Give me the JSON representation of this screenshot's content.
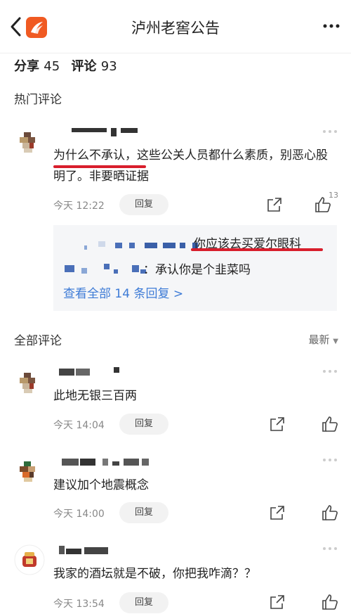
{
  "nav": {
    "title": "泸州老窖公告"
  },
  "stats": {
    "share_label": "分享",
    "share_count": "45",
    "comment_label": "评论",
    "comment_count": "93"
  },
  "hot": {
    "section_title": "热门评论",
    "comment": {
      "text_highlight": "为什么不承认",
      "text_rest": "，这些公关人员都什么素质，别恶心股明了。非要晒证据",
      "time": "今天 12:22",
      "reply_label": "回复",
      "likes": "13"
    },
    "replies": [
      {
        "text": "你应该去买爱尔眼科"
      },
      {
        "text": "承认你是个韭菜吗"
      }
    ],
    "view_all": "查看全部 14 条回复 >"
  },
  "all": {
    "section_title": "全部评论",
    "sort_label": "最新",
    "comments": [
      {
        "text": "此地无银三百两",
        "time": "今天 14:04",
        "reply_label": "回复"
      },
      {
        "text": "建议加个地震概念",
        "time": "今天 14:00",
        "reply_label": "回复"
      },
      {
        "text": "我家的酒坛就是不破，你把我咋滴？？",
        "time": "今天 13:54",
        "reply_label": "回复"
      }
    ]
  },
  "colors": {
    "logo": "#f05a22",
    "link": "#3d7bd6",
    "highlight_underline": "#d81e2c"
  },
  "icons": [
    "back-arrow-icon",
    "app-logo-icon",
    "more-dots-icon",
    "share-icon",
    "thumb-up-icon"
  ]
}
